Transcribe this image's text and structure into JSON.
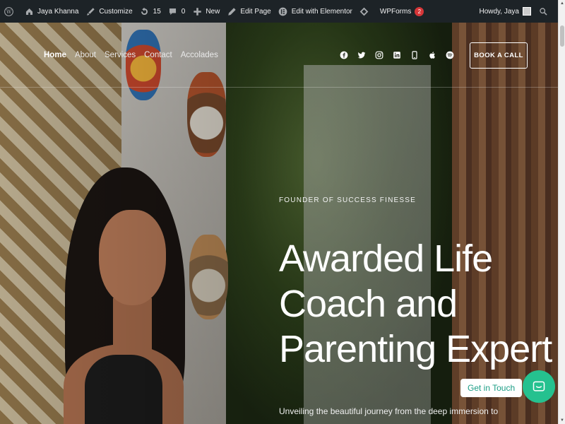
{
  "adminbar": {
    "site_name": "Jaya Khanna",
    "customize": "Customize",
    "updates": "15",
    "comments": "0",
    "new": "New",
    "edit_page": "Edit Page",
    "elementor": "Edit with Elementor",
    "wpforms": "WPForms",
    "wpforms_count": "2",
    "howdy": "Howdy, Jaya"
  },
  "nav": {
    "items": [
      "Home",
      "About",
      "Services",
      "Contact",
      "Accolades"
    ]
  },
  "socials": [
    "facebook-icon",
    "twitter-icon",
    "instagram-icon",
    "linkedin-icon",
    "phone-icon",
    "apple-icon",
    "spotify-icon"
  ],
  "header": {
    "cta": "BOOK A CALL"
  },
  "hero": {
    "eyebrow": "FOUNDER OF SUCCESS FINESSE",
    "headline_1": "Awarded Life",
    "headline_2": "Coach and",
    "headline_3": "Parenting Expert",
    "subline": "Unveiling the beautiful journey from the deep immersion to"
  },
  "widget": {
    "label": "Get in Touch"
  },
  "colors": {
    "adminbar": "#1d2327",
    "accent": "#25c18f",
    "badge": "#d63638"
  }
}
